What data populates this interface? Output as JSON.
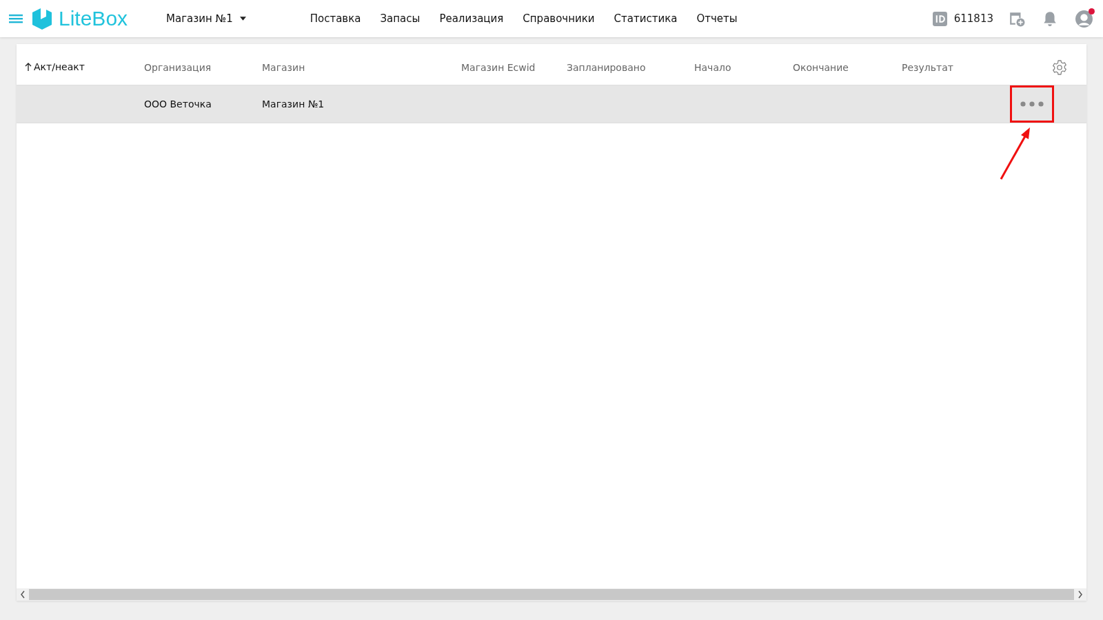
{
  "header": {
    "brand": "LiteBox",
    "store_selector": "Магазин №1",
    "nav": [
      {
        "label": "Поставка"
      },
      {
        "label": "Запасы"
      },
      {
        "label": "Реализация"
      },
      {
        "label": "Справочники"
      },
      {
        "label": "Статистика"
      },
      {
        "label": "Отчеты"
      }
    ],
    "account_id": "611813",
    "notification": true
  },
  "table": {
    "columns": [
      {
        "label": "Акт/неакт",
        "sorted": true
      },
      {
        "label": "Организация",
        "sorted": false
      },
      {
        "label": "Магазин",
        "sorted": false
      },
      {
        "label": "Магазин Ecwid",
        "sorted": false
      },
      {
        "label": "Запланировано",
        "sorted": false
      },
      {
        "label": "Начало",
        "sorted": false
      },
      {
        "label": "Окончание",
        "sorted": false
      },
      {
        "label": "Результат",
        "sorted": false
      }
    ],
    "rows": [
      {
        "cells": [
          "",
          "ООО Веточка",
          "Магазин №1",
          "",
          "",
          "",
          "",
          ""
        ],
        "selected": true,
        "actions_highlighted": true
      }
    ]
  }
}
